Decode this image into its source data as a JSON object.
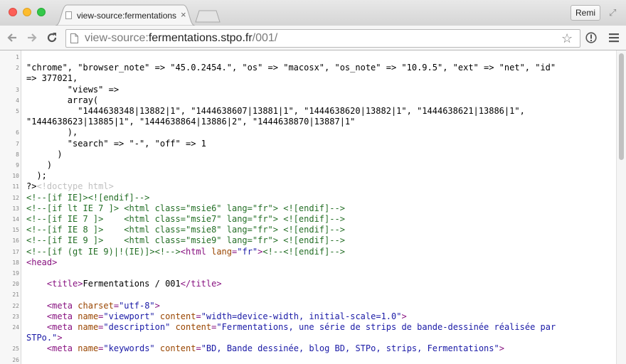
{
  "window": {
    "tab_title": "view-source:fermentations",
    "tab_close": "×",
    "profile_name": "Remi"
  },
  "toolbar": {
    "url_prefix": "view-source:",
    "url_host": "fermentations.stpo.fr",
    "url_path": "/001/",
    "star_glyph": "☆"
  },
  "source": {
    "lines": [
      {
        "n": "1",
        "html": ""
      },
      {
        "n": "2",
        "html": "\"chrome\", \"browser_note\" =&gt; \"45.0.2454.\", \"os\" =&gt; \"macosx\", \"os_note\" =&gt; \"10.9.5\", \"ext\" =&gt; \"net\", \"id\""
      },
      {
        "n": "",
        "html": "=&gt; 377021,"
      },
      {
        "n": "3",
        "html": "        \"views\" =&gt;"
      },
      {
        "n": "4",
        "html": "        array("
      },
      {
        "n": "5",
        "html": "          \"1444638348|13882|1\", \"1444638607|13881|1\", \"1444638620|13882|1\", \"1444638621|13886|1\","
      },
      {
        "n": "",
        "html": "\"1444638623|13885|1\", \"1444638864|13886|2\", \"1444638870|13887|1\""
      },
      {
        "n": "6",
        "html": "        ),"
      },
      {
        "n": "7",
        "html": "        \"search\" =&gt; \"-\", \"off\" =&gt; 1"
      },
      {
        "n": "8",
        "html": "      )"
      },
      {
        "n": "9",
        "html": "    )"
      },
      {
        "n": "10",
        "html": "  );"
      },
      {
        "n": "11",
        "html": "?&gt;<span class=\"doct\">&lt;!doctype html&gt;</span>"
      },
      {
        "n": "12",
        "html": "<span class=\"cmt\">&lt;!--[if IE]&gt;&lt;![endif]--&gt;</span>"
      },
      {
        "n": "13",
        "html": "<span class=\"cmt\">&lt;!--[if lt IE 7 ]&gt; &lt;html class=\"msie6\" lang=\"fr\"&gt; &lt;![endif]--&gt;</span>"
      },
      {
        "n": "14",
        "html": "<span class=\"cmt\">&lt;!--[if IE 7 ]&gt;    &lt;html class=\"msie7\" lang=\"fr\"&gt; &lt;![endif]--&gt;</span>"
      },
      {
        "n": "15",
        "html": "<span class=\"cmt\">&lt;!--[if IE 8 ]&gt;    &lt;html class=\"msie8\" lang=\"fr\"&gt; &lt;![endif]--&gt;</span>"
      },
      {
        "n": "16",
        "html": "<span class=\"cmt\">&lt;!--[if IE 9 ]&gt;    &lt;html class=\"msie9\" lang=\"fr\"&gt; &lt;![endif]--&gt;</span>"
      },
      {
        "n": "17",
        "html": "<span class=\"cmt\">&lt;!--[if (gt IE 9)|!(IE)]&gt;&lt;!--&gt;</span><span class=\"tag\">&lt;html </span><span class=\"attr\">lang</span><span class=\"tag\">=</span><span class=\"val\">\"fr\"</span><span class=\"tag\">&gt;</span><span class=\"cmt\">&lt;!--&lt;![endif]--&gt;</span>"
      },
      {
        "n": "18",
        "html": "<span class=\"tag\">&lt;head&gt;</span>"
      },
      {
        "n": "19",
        "html": ""
      },
      {
        "n": "20",
        "html": "    <span class=\"tag\">&lt;title&gt;</span>Fermentations / 001<span class=\"tag\">&lt;/title&gt;</span>"
      },
      {
        "n": "21",
        "html": ""
      },
      {
        "n": "22",
        "html": "    <span class=\"tag\">&lt;meta </span><span class=\"attr\">charset</span><span class=\"tag\">=</span><span class=\"val\">\"utf-8\"</span><span class=\"tag\">&gt;</span>"
      },
      {
        "n": "23",
        "html": "    <span class=\"tag\">&lt;meta </span><span class=\"attr\">name</span><span class=\"tag\">=</span><span class=\"val\">\"viewport\"</span> <span class=\"attr\">content</span><span class=\"tag\">=</span><span class=\"val\">\"width=device-width, initial-scale=1.0\"</span><span class=\"tag\">&gt;</span>"
      },
      {
        "n": "24",
        "html": "    <span class=\"tag\">&lt;meta </span><span class=\"attr\">name</span><span class=\"tag\">=</span><span class=\"val\">\"description\"</span> <span class=\"attr\">content</span><span class=\"tag\">=</span><span class=\"val\">\"Fermentations, une série de strips de bande-dessinée réalisée par</span>"
      },
      {
        "n": "",
        "html": "<span class=\"val\">STPo.\"</span><span class=\"tag\">&gt;</span>"
      },
      {
        "n": "25",
        "html": "    <span class=\"tag\">&lt;meta </span><span class=\"attr\">name</span><span class=\"tag\">=</span><span class=\"val\">\"keywords\"</span> <span class=\"attr\">content</span><span class=\"tag\">=</span><span class=\"val\">\"BD, Bande dessinée, blog BD, STPo, strips, Fermentations\"</span><span class=\"tag\">&gt;</span>"
      },
      {
        "n": "26",
        "html": ""
      }
    ]
  }
}
